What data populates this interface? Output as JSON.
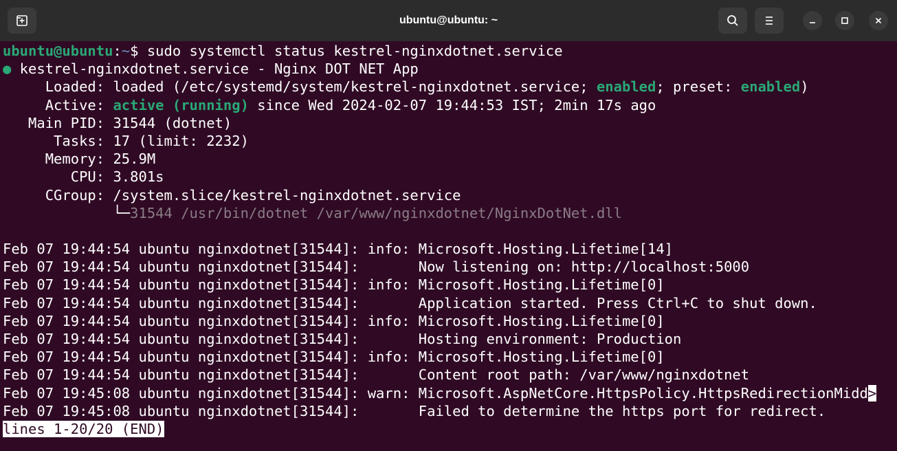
{
  "window": {
    "title": "ubuntu@ubuntu: ~",
    "icons": {
      "new_tab": "new-tab-icon",
      "search": "search-icon",
      "menu": "hamburger-menu-icon",
      "minimize": "minimize-icon",
      "maximize": "maximize-icon",
      "close": "close-icon"
    }
  },
  "colors": {
    "terminal_bg": "#300a24",
    "titlebar_bg": "#2c2c2c",
    "prompt_user": "#2aa876",
    "prompt_path": "#6e8fbe",
    "status_green": "#2aa876",
    "dim_text": "#8a7c86"
  },
  "terminal": {
    "prompt": {
      "user": "ubuntu@ubuntu",
      "colon": ":",
      "path": "~",
      "symbol": "$ ",
      "command": "sudo systemctl status kestrel-nginxdotnet.service"
    },
    "status": {
      "header": {
        "bullet": "●",
        "text": " kestrel-nginxdotnet.service - Nginx DOT NET App"
      },
      "loaded": {
        "label": "     Loaded: ",
        "before": "loaded (/etc/systemd/system/kestrel-nginxdotnet.service; ",
        "enabled1": "enabled",
        "mid": "; preset: ",
        "enabled2": "enabled",
        "after": ")"
      },
      "active": {
        "label": "     Active: ",
        "state": "active (running)",
        "rest": " since Wed 2024-02-07 19:44:53 IST; 2min 17s ago"
      },
      "main_pid": "   Main PID: 31544 (dotnet)",
      "tasks": "      Tasks: 17 (limit: 2232)",
      "memory": "     Memory: 25.9M",
      "cpu": "        CPU: 3.801s",
      "cgroup": "     CGroup: /system.slice/kestrel-nginxdotnet.service",
      "cgroup_child_tree": "             └─",
      "cgroup_child": "31544 /usr/bin/dotnet /var/www/nginxdotnet/NginxDotNet.dll"
    },
    "logs": [
      "Feb 07 19:44:54 ubuntu nginxdotnet[31544]: info: Microsoft.Hosting.Lifetime[14]",
      "Feb 07 19:44:54 ubuntu nginxdotnet[31544]:       Now listening on: http://localhost:5000",
      "Feb 07 19:44:54 ubuntu nginxdotnet[31544]: info: Microsoft.Hosting.Lifetime[0]",
      "Feb 07 19:44:54 ubuntu nginxdotnet[31544]:       Application started. Press Ctrl+C to shut down.",
      "Feb 07 19:44:54 ubuntu nginxdotnet[31544]: info: Microsoft.Hosting.Lifetime[0]",
      "Feb 07 19:44:54 ubuntu nginxdotnet[31544]:       Hosting environment: Production",
      "Feb 07 19:44:54 ubuntu nginxdotnet[31544]: info: Microsoft.Hosting.Lifetime[0]",
      "Feb 07 19:44:54 ubuntu nginxdotnet[31544]:       Content root path: /var/www/nginxdotnet",
      "Feb 07 19:45:08 ubuntu nginxdotnet[31544]: warn: Microsoft.AspNetCore.HttpsPolicy.HttpsRedirectionMidd",
      "Feb 07 19:45:08 ubuntu nginxdotnet[31544]:       Failed to determine the https port for redirect."
    ],
    "truncation_marker": ">",
    "pager_status": "lines 1-20/20 (END)"
  }
}
